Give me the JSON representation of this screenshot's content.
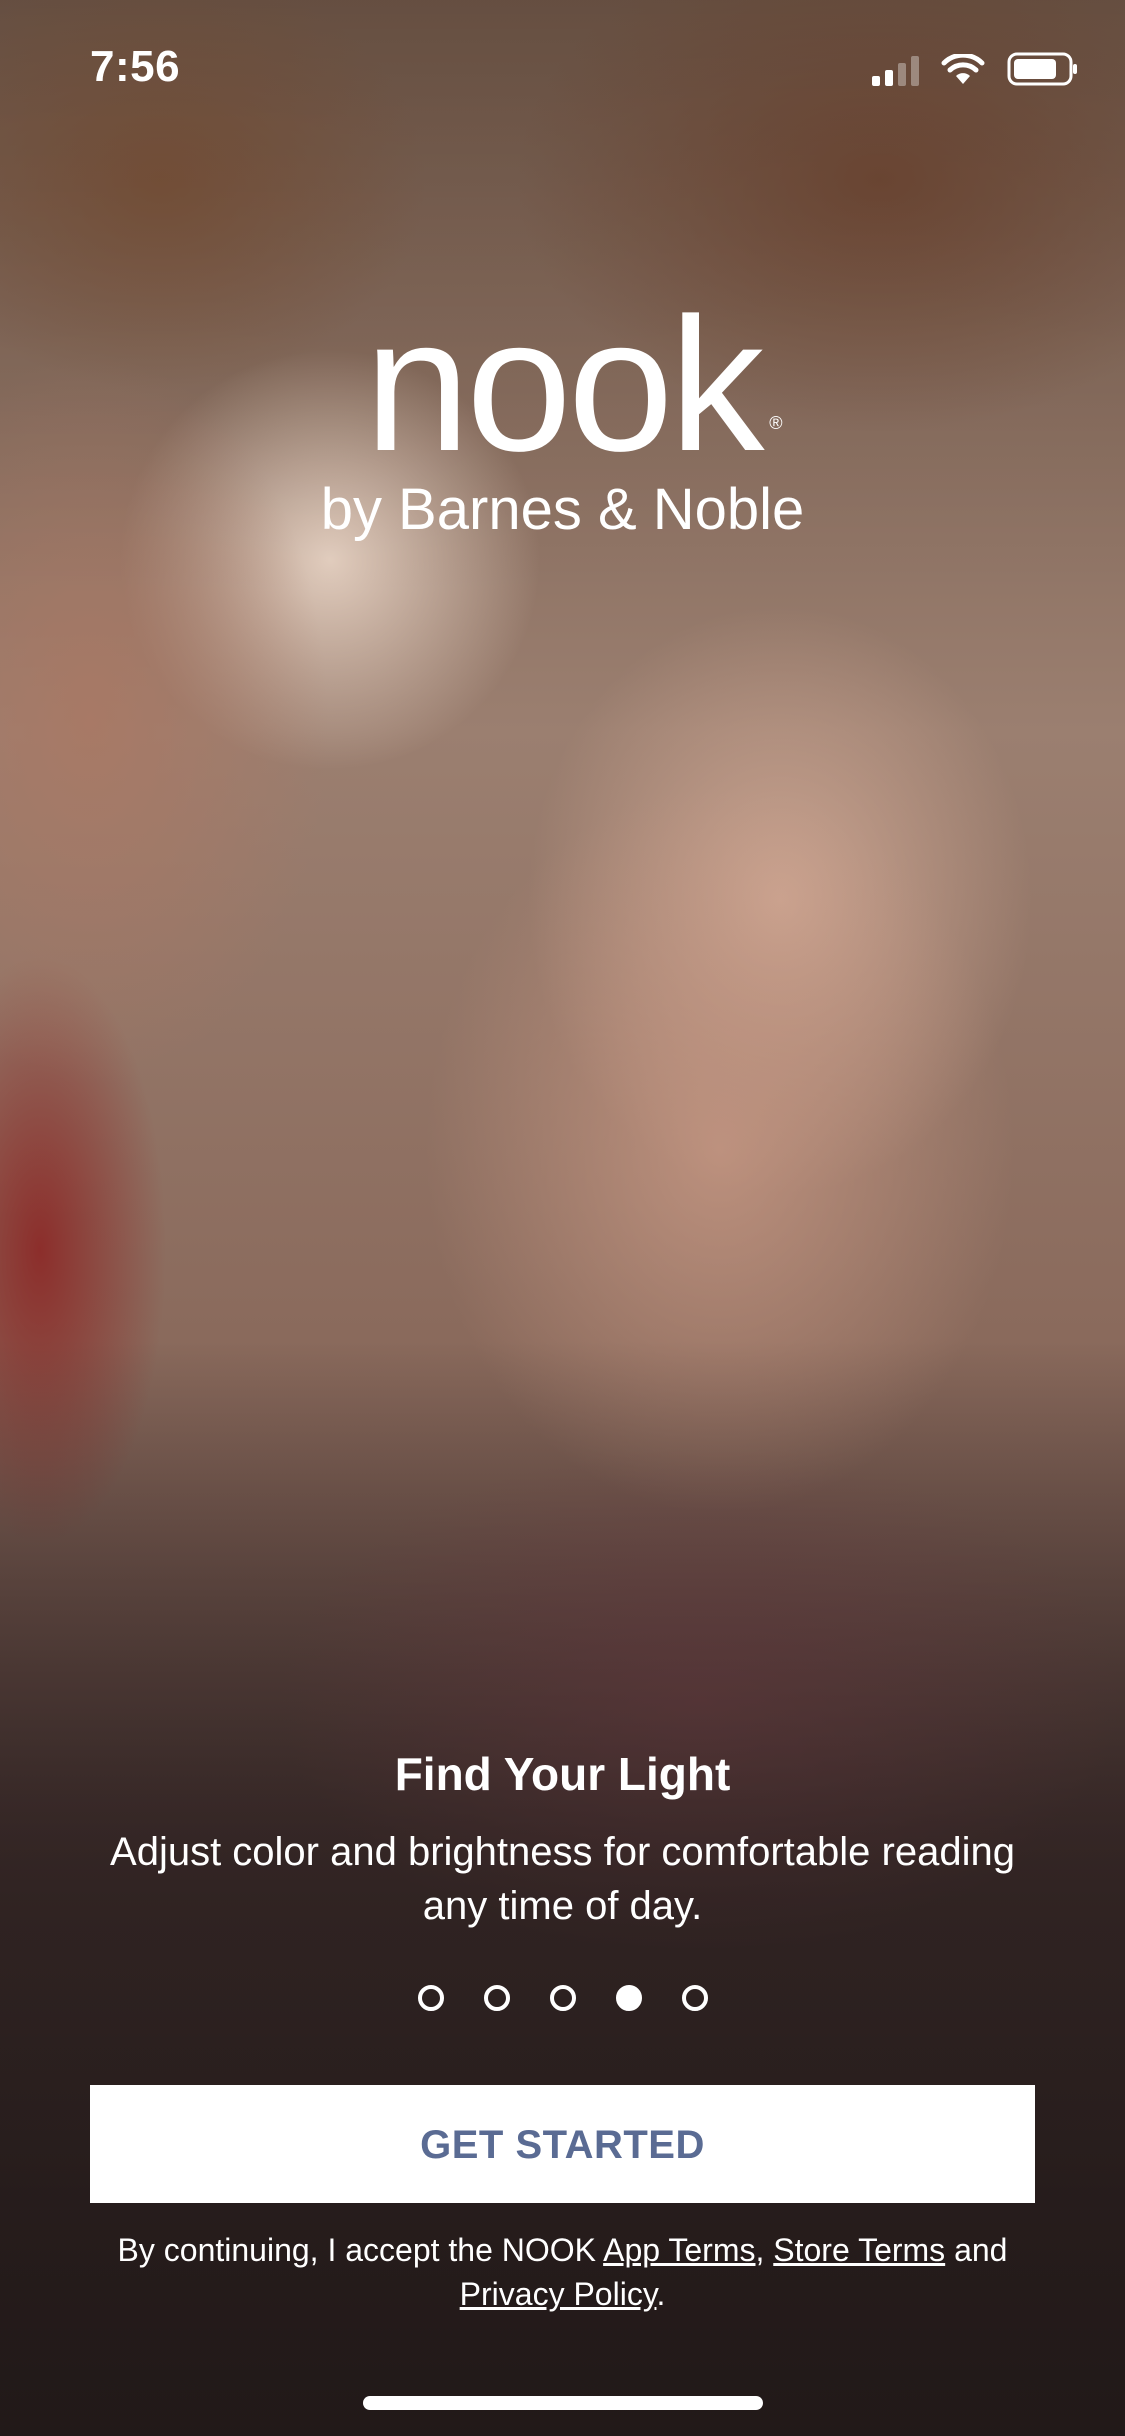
{
  "status_bar": {
    "time": "7:56"
  },
  "logo": {
    "wordmark": "nook",
    "registered": "®",
    "tagline": "by Barnes & Noble"
  },
  "onboarding": {
    "title": "Find Your Light",
    "description": "Adjust color and brightness for comfortable reading any time of day.",
    "page_count": 5,
    "active_page": 4
  },
  "cta": {
    "label": "GET STARTED"
  },
  "legal": {
    "prefix": "By continuing, I accept the NOOK ",
    "app_terms": "App Terms",
    "comma": ", ",
    "store_terms": "Store Terms",
    "and": " and ",
    "privacy_policy": "Privacy Policy",
    "suffix": "."
  },
  "colors": {
    "button_background": "#ffffff",
    "button_text": "#5a6b93",
    "text": "#ffffff"
  }
}
